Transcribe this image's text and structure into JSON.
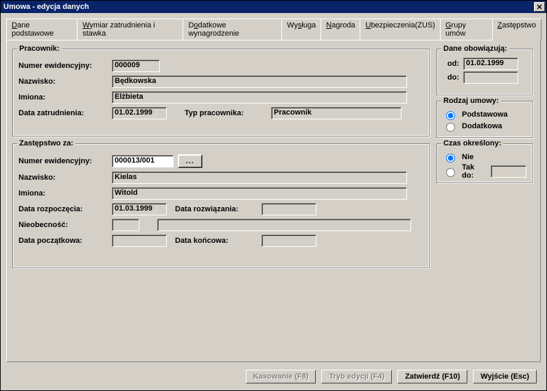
{
  "title": "Umowa - edycja danych",
  "tabs": {
    "t0": "Dane podstawowe",
    "t1": "Wymiar zatrudnienia i stawka",
    "t2": "Dodatkowe wynagrodzenie",
    "t3": "Wysługa",
    "t4": "Nagroda",
    "t5": "Ubezpieczenia(ZUS)",
    "t6": "Grupy umów",
    "t7": "Zastępstwo"
  },
  "pracownik": {
    "legend": "Pracownik:",
    "numer_label": "Numer ewidencyjny:",
    "numer": "000009",
    "nazwisko_label": "Nazwisko:",
    "nazwisko": "Będkowska",
    "imiona_label": "Imiona:",
    "imiona": "Elżbieta",
    "data_zatr_label": "Data zatrudnienia:",
    "data_zatr": "01.02.1999",
    "typ_label": "Typ pracownika:",
    "typ": "Pracownik"
  },
  "zastepstwo": {
    "legend": "Zastępstwo za:",
    "numer_label": "Numer ewidencyjny:",
    "numer": "000013/001",
    "browse": "...",
    "nazwisko_label": "Nazwisko:",
    "nazwisko": "Kielas",
    "imiona_label": "Imiona:",
    "imiona": "Witold",
    "data_rozp_label": "Data rozpoczęcia:",
    "data_rozp": "01.03.1999",
    "data_rozw_label": "Data rozwiązania:",
    "data_rozw": "",
    "nieob_label": "Nieobecność:",
    "nieob_code": "",
    "nieob_desc": "",
    "data_pocz_label": "Data początkowa:",
    "data_pocz": "",
    "data_konc_label": "Data końcowa:",
    "data_konc": ""
  },
  "dane_obow": {
    "legend": "Dane obowiązują:",
    "od_label": "od:",
    "od": "01.02.1999",
    "do_label": "do:",
    "do": ""
  },
  "rodzaj": {
    "legend": "Rodzaj umowy:",
    "opt1": "Podstawowa",
    "opt2": "Dodatkowa",
    "selected": "Podstawowa"
  },
  "czas": {
    "legend": "Czas określony:",
    "opt1": "Nie",
    "opt2": "Tak do:",
    "selected": "Nie",
    "tak_do": ""
  },
  "buttons": {
    "kasowanie": "Kasowanie (F8)",
    "tryb": "Tryb edycji (F4)",
    "zatwierdz": "Zatwierdź (F10)",
    "wyjscie": "Wyjście (Esc)"
  }
}
